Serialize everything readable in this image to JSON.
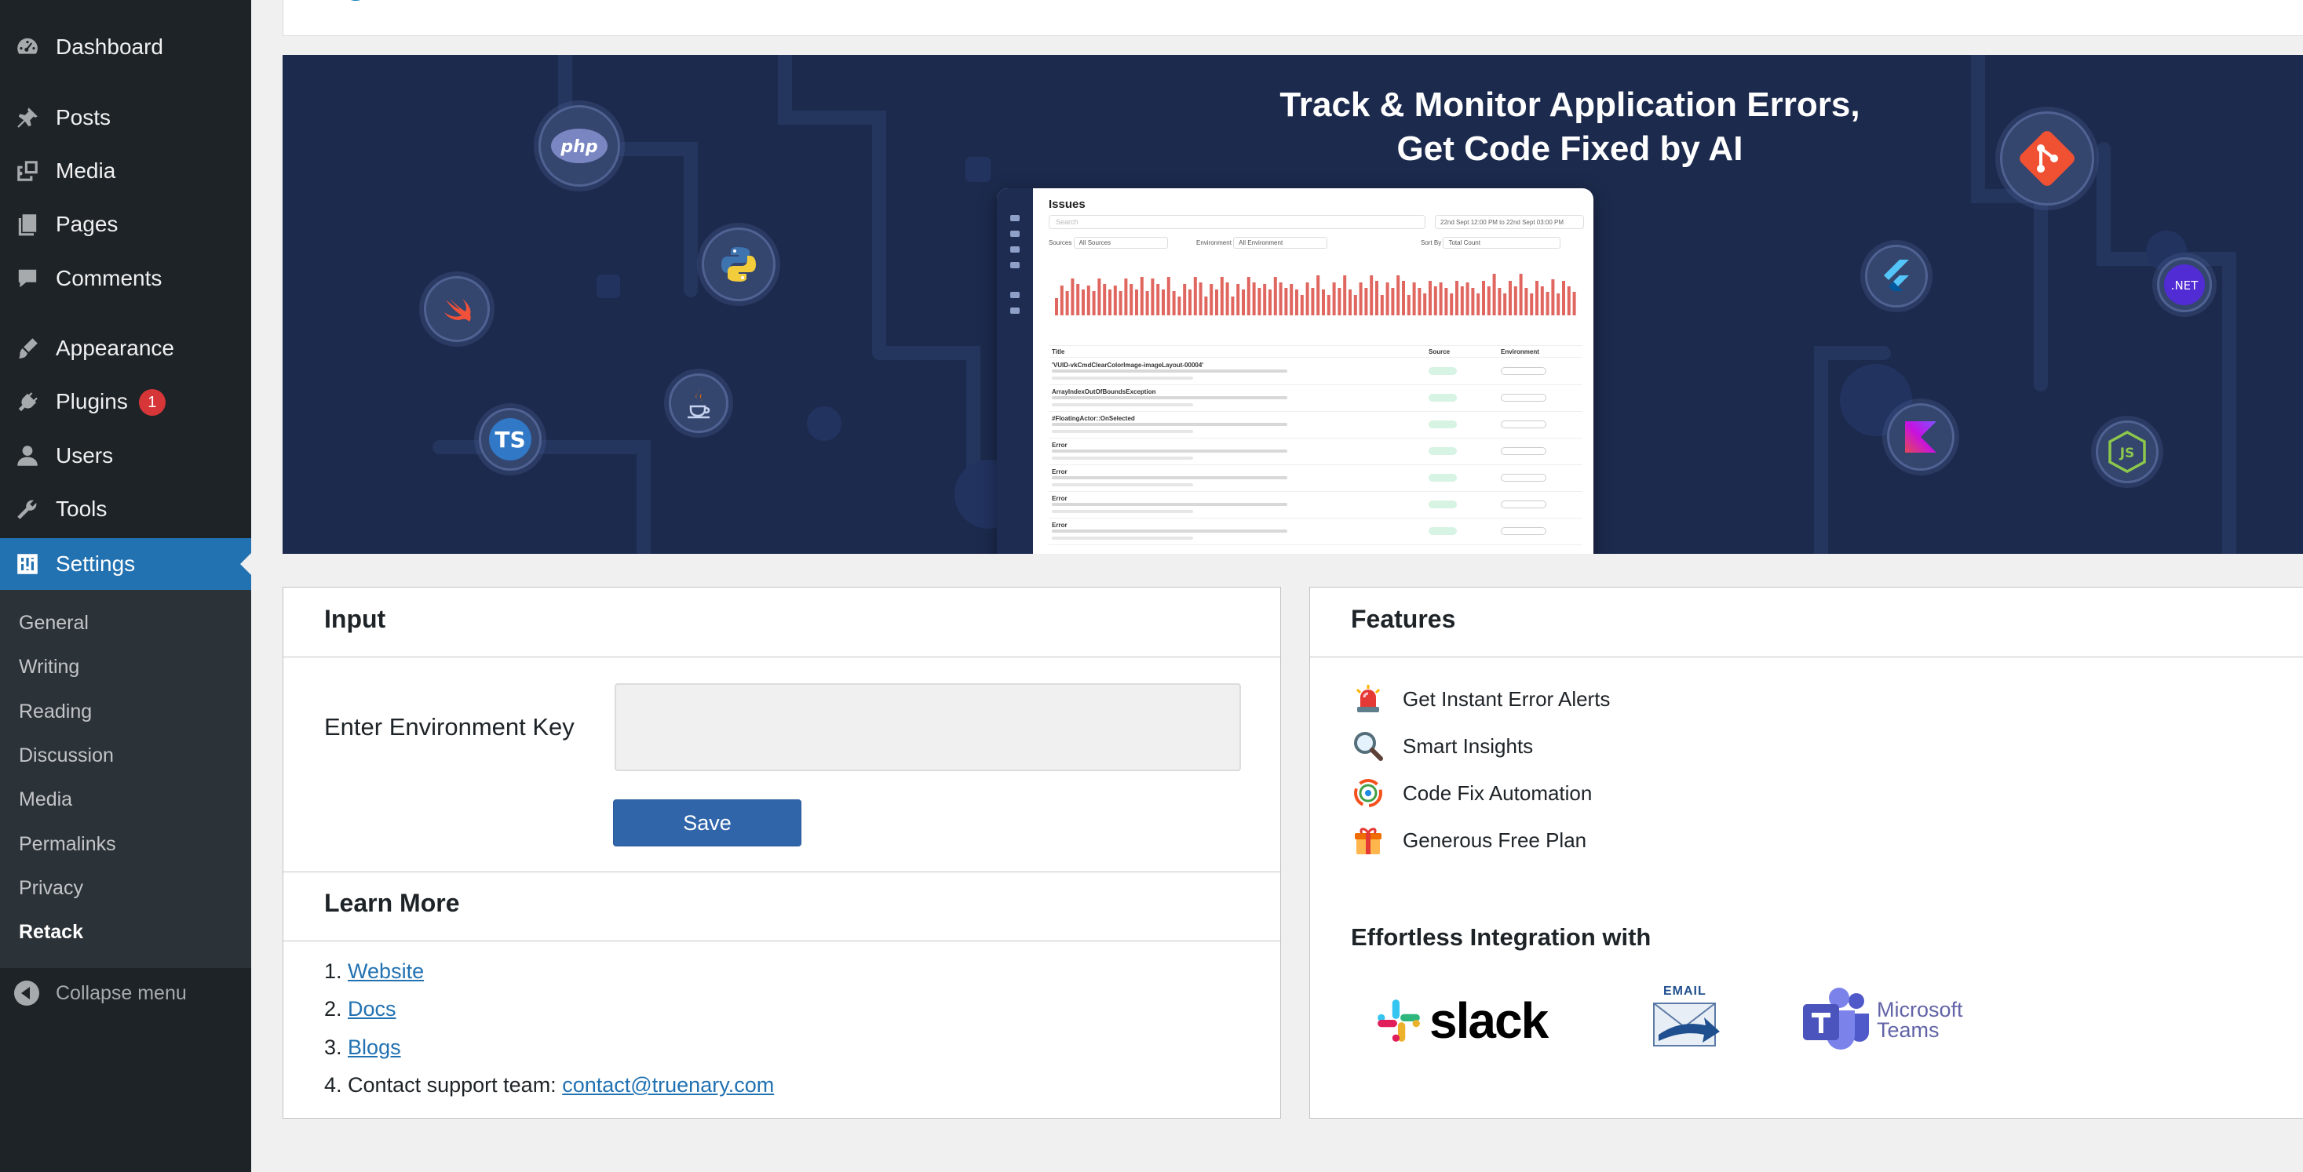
{
  "sidebar": {
    "items": [
      {
        "label": "Dashboard",
        "icon": "dashboard-icon"
      },
      {
        "label": "Posts",
        "icon": "pin-icon"
      },
      {
        "label": "Media",
        "icon": "media-icon"
      },
      {
        "label": "Pages",
        "icon": "pages-icon"
      },
      {
        "label": "Comments",
        "icon": "comment-icon"
      },
      {
        "label": "Appearance",
        "icon": "brush-icon"
      },
      {
        "label": "Plugins",
        "icon": "plug-icon",
        "badge": "1"
      },
      {
        "label": "Users",
        "icon": "user-icon"
      },
      {
        "label": "Tools",
        "icon": "wrench-icon"
      },
      {
        "label": "Settings",
        "icon": "settings-icon",
        "active": true
      }
    ],
    "submenu": [
      "General",
      "Writing",
      "Reading",
      "Discussion",
      "Media",
      "Permalinks",
      "Privacy",
      "Retack"
    ],
    "current_submenu": "Retack",
    "collapse_label": "Collapse menu"
  },
  "banner": {
    "title_line1": "Track & Monitor Application Errors,",
    "title_line2": "Get Code Fixed by AI",
    "tech_icons": [
      "php-icon",
      "python-icon",
      "swift-icon",
      "java-icon",
      "typescript-icon",
      "git-icon",
      "flutter-icon",
      "dotnet-icon",
      "kotlin-icon",
      "nodejs-icon"
    ],
    "mockup": {
      "title": "Issues",
      "search_placeholder": "Search",
      "date_range": "22nd Sept 12:00 PM to 22nd Sept 03:00 PM",
      "sources_label": "Sources",
      "sources_value": "All Sources",
      "environment_label": "Environment",
      "environment_value": "All Environment",
      "sort_label": "Sort By",
      "sort_value": "Total Count",
      "col_title": "Title",
      "col_source": "Source",
      "col_environment": "Environment",
      "rows": [
        "'VUID-vkCmdClearColorImage-imageLayout-00004'",
        "ArrayIndexOutOfBoundsException",
        "#FloatingActor::OnSelected",
        "Error",
        "Error",
        "Error",
        "Error"
      ]
    }
  },
  "input_card": {
    "title": "Input",
    "env_label": "Enter Environment Key",
    "env_value": "",
    "save_label": "Save"
  },
  "learn_more": {
    "title": "Learn More",
    "items": [
      {
        "num": "1.",
        "text": "",
        "link": "Website"
      },
      {
        "num": "2.",
        "text": "",
        "link": "Docs"
      },
      {
        "num": "3.",
        "text": "",
        "link": "Blogs"
      },
      {
        "num": "4.",
        "text": "Contact support team: ",
        "link": "contact@truenary.com"
      }
    ]
  },
  "features": {
    "title": "Features",
    "items": [
      {
        "label": "Get Instant Error Alerts",
        "icon": "siren-icon"
      },
      {
        "label": "Smart Insights",
        "icon": "magnifier-icon"
      },
      {
        "label": "Code Fix Automation",
        "icon": "automation-icon"
      },
      {
        "label": "Generous Free Plan",
        "icon": "gift-icon"
      }
    ],
    "integration_title": "Effortless Integration with",
    "integrations": {
      "slack": "slack",
      "email": "EMAIL",
      "teams_line1": "Microsoft",
      "teams_line2": "Teams"
    }
  },
  "colors": {
    "sidebar_bg": "#1d2327",
    "submenu_bg": "#2c3338",
    "active_bg": "#2271b1",
    "banner_bg": "#1c2a4d",
    "save_button": "#3065aa",
    "link": "#2271b1",
    "badge": "#d63638"
  }
}
